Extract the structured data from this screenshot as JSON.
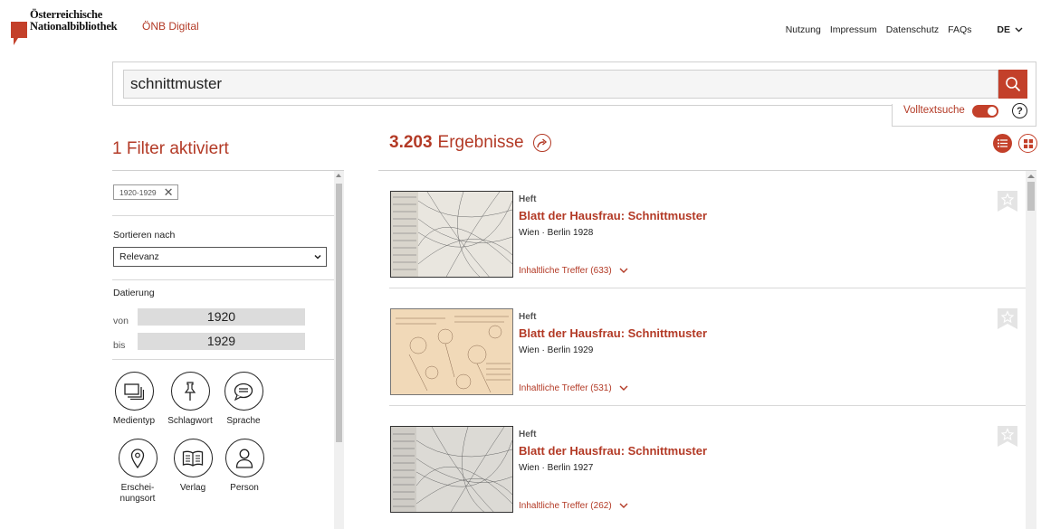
{
  "header": {
    "logo_line1": "Österreichische",
    "logo_line2": "Nationalbibliothek",
    "brand_sub": "ÖNB Digital",
    "nav": [
      "Nutzung",
      "Impressum",
      "Datenschutz",
      "FAQs"
    ],
    "language": "DE"
  },
  "search": {
    "query": "schnittmuster",
    "fulltext_label": "Volltextsuche",
    "fulltext_enabled": true,
    "help_glyph": "?"
  },
  "filters": {
    "title": "1 Filter aktiviert",
    "active_chip": "1920-1929",
    "sort_label": "Sortieren nach",
    "sort_value": "Relevanz",
    "dating_label": "Datierung",
    "from_label": "von",
    "from_value": "1920",
    "to_label": "bis",
    "to_value": "1929",
    "facets": [
      {
        "label": "Medientyp",
        "icon": "media-type-icon"
      },
      {
        "label": "Schlagwort",
        "icon": "pin-icon"
      },
      {
        "label": "Sprache",
        "icon": "speech-bubble-icon"
      },
      {
        "label": "Erschei-\nnungsort",
        "icon": "location-pin-icon"
      },
      {
        "label": "Verlag",
        "icon": "open-book-icon"
      },
      {
        "label": "Person",
        "icon": "person-icon"
      }
    ]
  },
  "results": {
    "count": "3.203",
    "count_label": "Ergebnisse",
    "items": [
      {
        "type": "Heft",
        "title": "Blatt der Hausfrau: Schnittmuster",
        "meta": "Wien · Berlin 1928",
        "hits": "Inhaltliche Treffer (633)",
        "thumb": "#e9e6df"
      },
      {
        "type": "Heft",
        "title": "Blatt der Hausfrau: Schnittmuster",
        "meta": "Wien · Berlin 1929",
        "hits": "Inhaltliche Treffer (531)",
        "thumb": "#f1d9b8"
      },
      {
        "type": "Heft",
        "title": "Blatt der Hausfrau: Schnittmuster",
        "meta": "Wien · Berlin 1927",
        "hits": "Inhaltliche Treffer (262)",
        "thumb": "#dcdad5"
      }
    ]
  },
  "colors": {
    "accent": "#c3402a",
    "accent_text": "#b33a26"
  }
}
